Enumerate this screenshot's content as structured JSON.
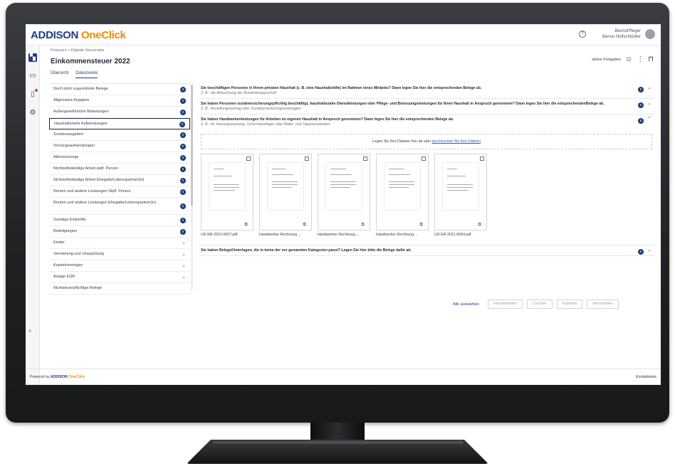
{
  "app": {
    "logo_main": "ADDISON",
    "logo_accent": "OneClick",
    "user_name": "BennoPfleger",
    "user_sub": "Benno Holtschlödter"
  },
  "header": {
    "breadcrumb": "Finanzen  >  Digitale Steuerakte",
    "title": "Einkommensteuer 2022",
    "active_shares": "aktive Freigaben"
  },
  "tabs": [
    "Übersicht",
    "Dokumente"
  ],
  "categories": [
    {
      "label": "Noch nicht zugeordnete Belege",
      "badge": "0"
    },
    {
      "label": "Allgemeine Angaben",
      "badge": "0"
    },
    {
      "label": "Außergewöhnliche Belastungen",
      "badge": "0"
    },
    {
      "label": "Haushaltsnahe Aufwendungen",
      "badge": "0"
    },
    {
      "label": "Sonderausgaben",
      "badge": "0"
    },
    {
      "label": "Vorsorgeaufwendungen",
      "badge": "0"
    },
    {
      "label": "Altersvorsorge",
      "badge": "0"
    },
    {
      "label": "Nichtselbständige Arbeit stpfl. Person",
      "badge": "0"
    },
    {
      "label": "Nichtselbständige Arbeit Ehegatte/Lebenspartner(in)",
      "badge": "0"
    },
    {
      "label": "Renten und andere Leistungen Stpfl. Person",
      "badge": "0"
    },
    {
      "label": "Renten und andere Leistungen Ehegatte/Lebenspartner(in)",
      "badge": "0"
    },
    {
      "label": "Sonstige Einkünfte",
      "badge": "0"
    },
    {
      "label": "Beteiligungen",
      "badge": "0"
    },
    {
      "label": "Kinder",
      "badge": ""
    },
    {
      "label": "Vermietung und Verpachtung",
      "badge": ""
    },
    {
      "label": "Kapitalvermögen",
      "badge": ""
    },
    {
      "label": "Anlage EÜR",
      "badge": ""
    },
    {
      "label": "Nichtsteuerpflichtige Belege",
      "badge": ""
    }
  ],
  "questions": [
    {
      "title": "Sie beschäftigen Personen in Ihrem privaten Haushalt (z. B. eine Haushaltshilfe) im Rahmen eines Minijobs? Dann legen Sie hier die entsprechenden Belege ab.",
      "hint": "Z. B.: die Abrechnung der Bundesknappschaft",
      "badge": "0"
    },
    {
      "title": "Sie haben Personen sozialversicherungspflichtig beschäftigt, haushaltsnahe Dienstleistungen oder Pflege- und Betreuungsleistungen für Ihren Haushalt in Anspruch genommen? Dann legen Sie hier die entsprechendenBelege ab.",
      "hint": "Z. B.: Anstellungsvertrag oder Sozialversicherungsunterlagen",
      "badge": "0"
    },
    {
      "title": "Sie haben Handwerkerleistungen für Arbeiten im eigenen Haushalt in Anspruch genommen? Dann legen Sie hier die entsprechenden Belege ab.",
      "hint": "Z. B.: für Heizungswartung, Schornsteinfeger oder Maler- und Tapezierarbeiten.",
      "badge": "5"
    },
    {
      "title": "Sie haben Belege/Unterlagen, die in keine der vor genannten Kategorien passt? Legen Sie hier bitte die Belege dafür ab.",
      "hint": "",
      "badge": "0"
    }
  ],
  "dropzone": {
    "text": "Legen Sie Ihre Dateien hier ab oder",
    "link": "durchsuchen Sie Ihre Dateien"
  },
  "files": [
    "UD-ER-2021-0007.pdf",
    "Handwerker Rechnung ...",
    "Handwerker Rechnung ...",
    "Handwerker Rechnung ...",
    "UD-ER-2021-0004.pdf"
  ],
  "actions": {
    "select_all": "Alle auswählen",
    "download": "Herunterladen",
    "delete": "Löschen",
    "copy": "Kopieren",
    "move": "Verschieben"
  },
  "footer": {
    "powered_by": "Powered by",
    "brand": "ADDISON",
    "brand_accent": "OneClick",
    "contact": "Kontaktkarte"
  },
  "colors": {
    "brand_blue": "#1d3e7a",
    "brand_orange": "#f08a00"
  }
}
